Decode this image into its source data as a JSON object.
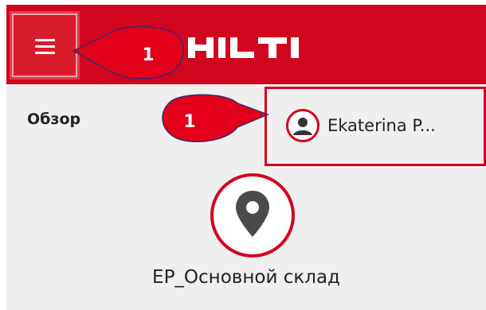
{
  "header": {
    "logo_text": "HILTI",
    "brand_color": "#d2051e",
    "menu_icon": "hamburger-menu-icon"
  },
  "main": {
    "title": "Обзор",
    "user": {
      "name": "Ekaterina P...",
      "icon": "user-avatar-icon"
    },
    "location": {
      "name": "EP_Основной склад",
      "icon": "map-pin-icon"
    }
  },
  "annotations": [
    {
      "label": "1",
      "color": "#e3001b"
    },
    {
      "label": "1",
      "color": "#e3001b"
    }
  ]
}
